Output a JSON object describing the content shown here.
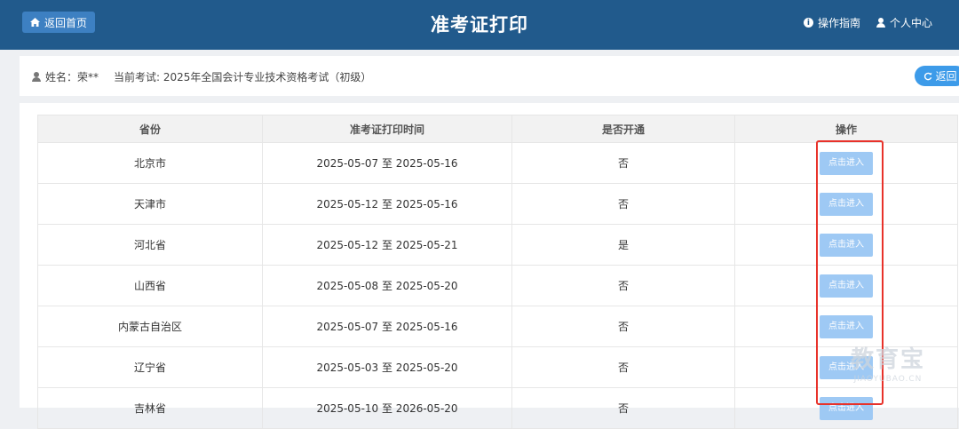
{
  "header": {
    "home_label": "返回首页",
    "title": "准考证打印",
    "guide_label": "操作指南",
    "user_center_label": "个人中心"
  },
  "info": {
    "name_text": "姓名：荣**",
    "exam_text": "当前考试: 2025年全国会计专业技术资格考试（初级）",
    "back_label": "返回"
  },
  "table": {
    "headers": [
      "省份",
      "准考证打印时间",
      "是否开通",
      "操作"
    ],
    "rows": [
      {
        "province": "北京市",
        "period": "2025-05-07 至 2025-05-16",
        "open": "否",
        "action": "点击进入"
      },
      {
        "province": "天津市",
        "period": "2025-05-12 至 2025-05-16",
        "open": "否",
        "action": "点击进入"
      },
      {
        "province": "河北省",
        "period": "2025-05-12 至 2025-05-21",
        "open": "是",
        "action": "点击进入"
      },
      {
        "province": "山西省",
        "period": "2025-05-08 至 2025-05-20",
        "open": "否",
        "action": "点击进入"
      },
      {
        "province": "内蒙古自治区",
        "period": "2025-05-07 至 2025-05-16",
        "open": "否",
        "action": "点击进入"
      },
      {
        "province": "辽宁省",
        "period": "2025-05-03 至 2025-05-20",
        "open": "否",
        "action": "点击进入"
      },
      {
        "province": "吉林省",
        "period": "2025-05-10 至 2026-05-20",
        "open": "否",
        "action": "点击进入"
      }
    ]
  },
  "watermark": {
    "main": "教育宝",
    "sub": "JIAOYUBAO.CN"
  },
  "colors": {
    "header_bg": "#215a8c",
    "button_blue": "#3d80c2",
    "enter_button": "#9ec9f4",
    "highlight": "#e8322a"
  }
}
